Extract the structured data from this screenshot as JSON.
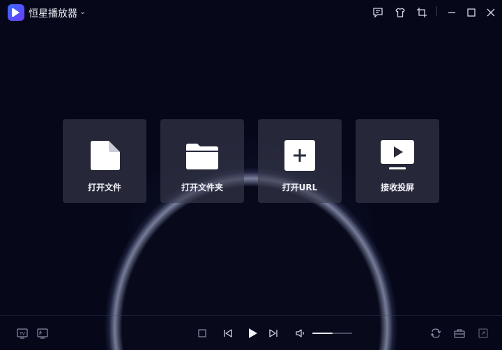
{
  "app": {
    "title": "恒星播放器"
  },
  "cards": [
    {
      "label": "打开文件",
      "icon": "file-icon"
    },
    {
      "label": "打开文件夹",
      "icon": "folder-icon"
    },
    {
      "label": "打开URL",
      "icon": "add-url-icon"
    },
    {
      "label": "接收投屏",
      "icon": "screen-cast-icon"
    }
  ],
  "titlebar_buttons": [
    "feedback-icon",
    "skin-icon",
    "crop-icon",
    "minimize-icon",
    "maximize-icon",
    "close-icon"
  ],
  "controls": {
    "volume_level": 0.5,
    "left_icons": [
      "tv-icon",
      "cast-icon"
    ],
    "center_icons": [
      "stop-icon",
      "previous-icon",
      "play-icon",
      "next-icon",
      "volume-icon"
    ],
    "right_icons": [
      "loop-icon",
      "toolbox-icon",
      "fullscreen-icon"
    ]
  },
  "colors": {
    "background": "#06081a",
    "card": "#3a3c4e",
    "accent": "#4a5cff"
  }
}
